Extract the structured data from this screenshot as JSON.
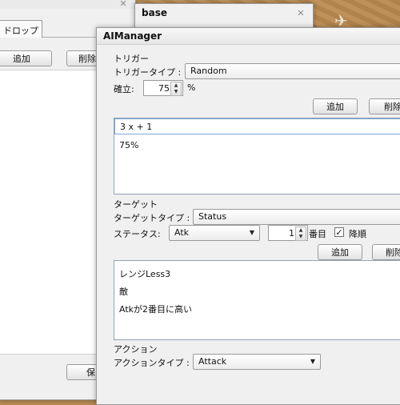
{
  "back_window": {
    "tab_label": "ドロップ",
    "add_label": "追加",
    "delete_label": "削除",
    "save_label": "保"
  },
  "base_window": {
    "title": "base"
  },
  "ai_manager": {
    "title": "AIManager",
    "trigger": {
      "section_label": "トリガー",
      "type_label": "トリガータイプ :",
      "type_value": "Random",
      "probability_label": "確立:",
      "probability_value": "75",
      "percent_sign": "%",
      "add_label": "追加",
      "delete_label": "削除",
      "list_lines": [
        "3 x + 1",
        "75%"
      ]
    },
    "target": {
      "section_label": "ターゲット",
      "type_label": "ターゲットタイプ :",
      "type_value": "Status",
      "status_label": "ステータス:",
      "status_value": "Atk",
      "rank_value": "1",
      "rank_suffix": "番目",
      "descending_label": "降順",
      "descending_checked": true,
      "add_label": "追加",
      "delete_label": "削除",
      "list_lines": [
        "レンジLess3",
        "敵",
        "Atkが2番目に高い"
      ]
    },
    "action": {
      "section_label": "アクション",
      "type_label": "アクションタイプ :",
      "type_value": "Attack"
    }
  }
}
